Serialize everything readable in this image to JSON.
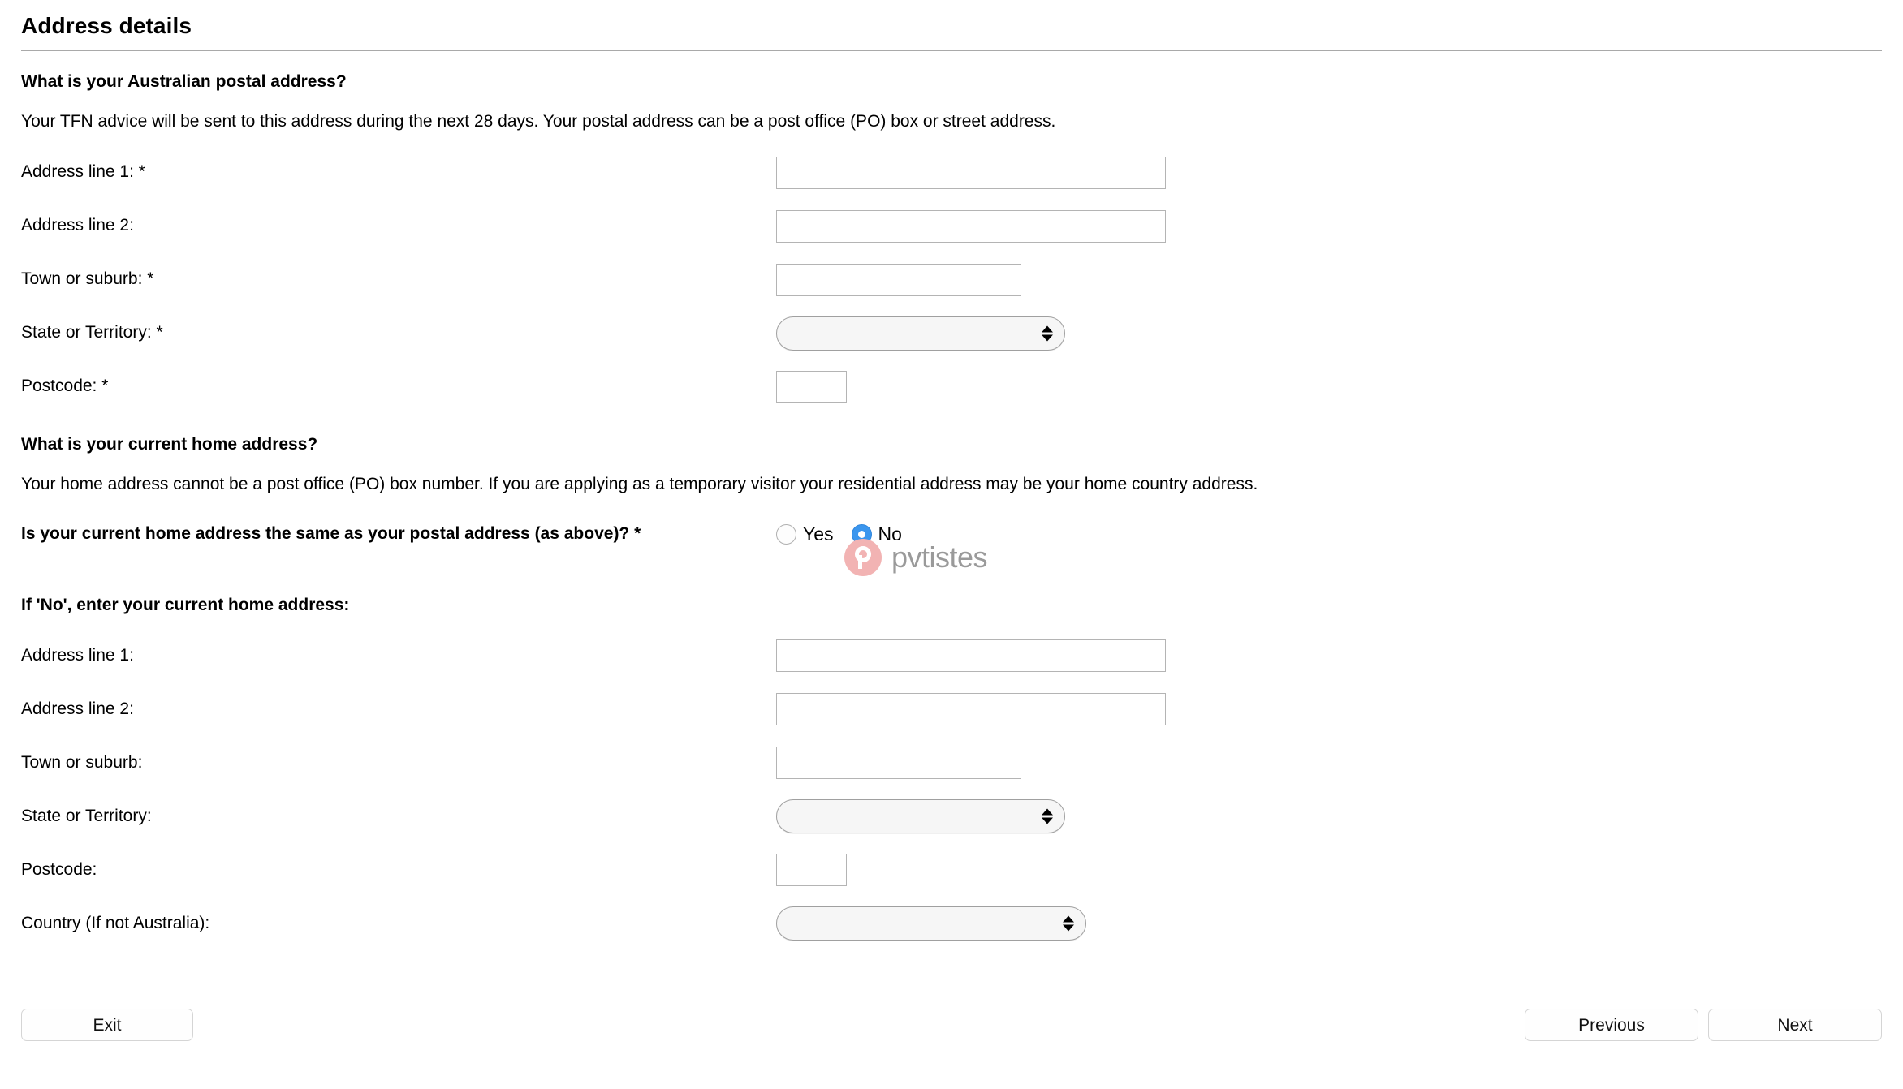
{
  "page": {
    "title": "Address details"
  },
  "postal_section": {
    "heading": "What is your Australian postal address?",
    "description": "Your TFN advice will be sent to this address during the next 28 days. Your postal address can be a post office (PO) box or street address.",
    "fields": [
      {
        "label": "Address line 1: *",
        "value": "",
        "type": "text"
      },
      {
        "label": "Address line 2:",
        "value": "",
        "type": "text"
      },
      {
        "label": "Town or suburb: *",
        "value": "",
        "type": "text"
      },
      {
        "label": "State or Territory: *",
        "value": "",
        "type": "select"
      },
      {
        "label": "Postcode: *",
        "value": "",
        "type": "text"
      }
    ]
  },
  "home_section": {
    "heading": "What is your current home address?",
    "description": "Your home address cannot be a post office (PO) box number. If you are applying as a temporary visitor your residential address may be your home country address.",
    "same_question": {
      "label": "Is your current home address the same as your postal address (as above)? *",
      "options": [
        {
          "label": "Yes",
          "selected": false
        },
        {
          "label": "No",
          "selected": true
        }
      ]
    },
    "if_no_heading": "If 'No', enter your current home address:",
    "fields": [
      {
        "label": "Address line 1:",
        "value": "",
        "type": "text"
      },
      {
        "label": "Address line 2:",
        "value": "",
        "type": "text"
      },
      {
        "label": "Town or suburb:",
        "value": "",
        "type": "text"
      },
      {
        "label": "State or Territory:",
        "value": "",
        "type": "select"
      },
      {
        "label": "Postcode:",
        "value": "",
        "type": "text"
      },
      {
        "label": "Country (If not Australia):",
        "value": "",
        "type": "select"
      }
    ]
  },
  "watermark": {
    "text": "pvtistes",
    "logo_color": "#f2b3b3",
    "text_color": "#9a9a9a"
  },
  "footer": {
    "exit_label": "Exit",
    "previous_label": "Previous",
    "next_label": "Next"
  },
  "colors": {
    "radio_selected": "#3b96ee",
    "rule": "#a9a9a9",
    "input_border": "#b4b4b4",
    "select_bg": "#f6f6f6"
  }
}
